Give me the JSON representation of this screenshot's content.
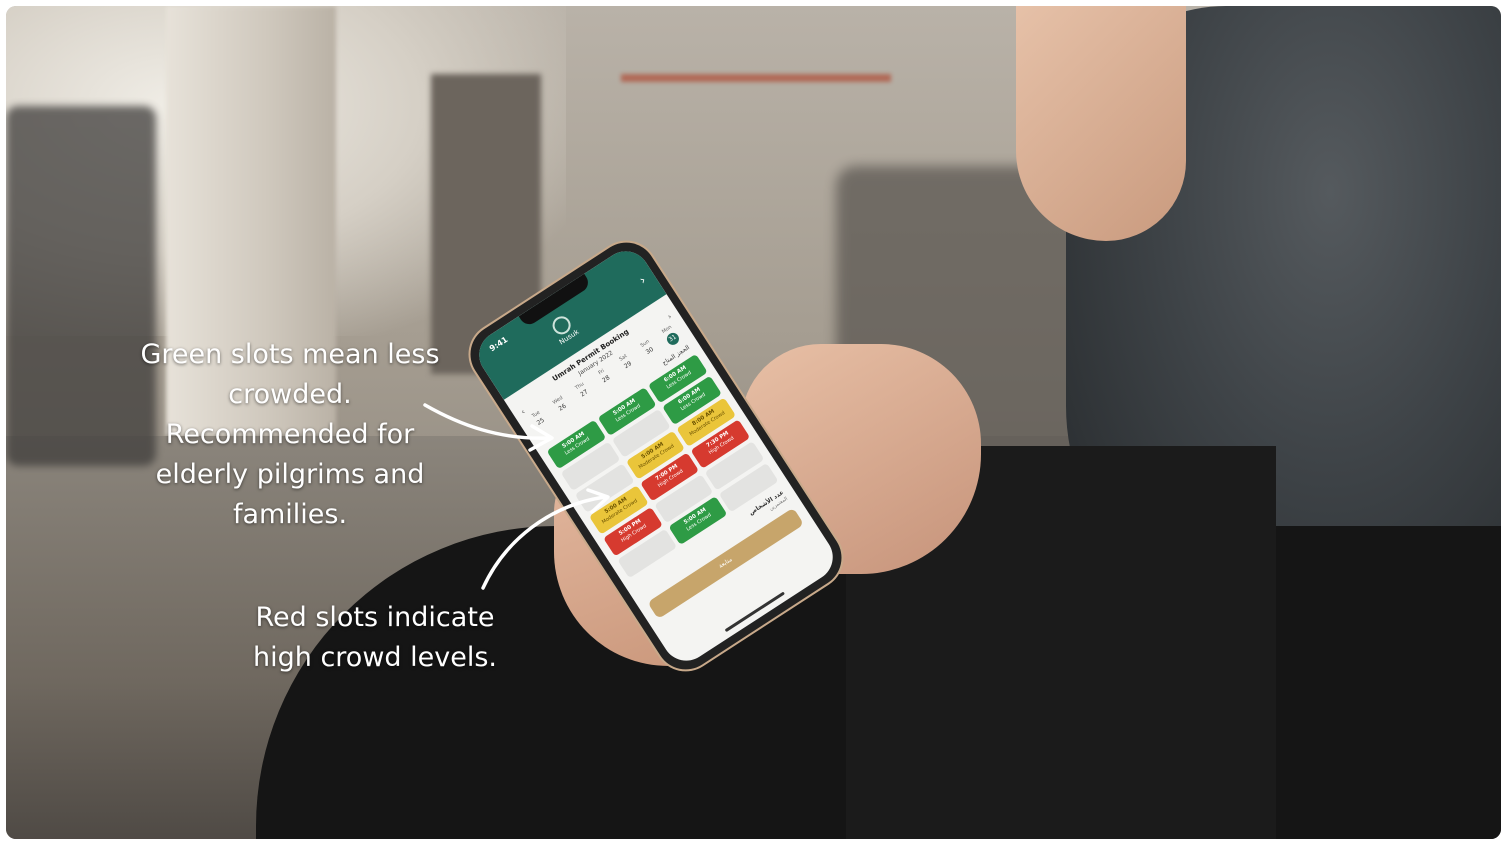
{
  "annotations": {
    "green_note": "Green slots mean less crowded. Recommended for elderly pilgrims and families.",
    "red_note": "Red slots indicate high crowd levels."
  },
  "phone": {
    "status_time": "9:41",
    "app_name": "Nusuk",
    "screen_title": "Umrah Permit Booking",
    "month": "January 2022",
    "days": [
      {
        "dow": "Tue",
        "num": "25"
      },
      {
        "dow": "Wed",
        "num": "26"
      },
      {
        "dow": "Thu",
        "num": "27"
      },
      {
        "dow": "Fri",
        "num": "28"
      },
      {
        "dow": "Sat",
        "num": "29"
      },
      {
        "dow": "Sun",
        "num": "30"
      },
      {
        "dow": "Mon",
        "num": "31"
      }
    ],
    "section_label": "الحجز المتاح",
    "slots": [
      {
        "time": "5:00 AM",
        "level": "Less Crowd",
        "color": "green"
      },
      {
        "time": "5:00 AM",
        "level": "Less Crowd",
        "color": "green"
      },
      {
        "time": "6:00 AM",
        "level": "Less Crowd",
        "color": "green"
      },
      {
        "time": "",
        "level": "",
        "color": "grey"
      },
      {
        "time": "",
        "level": "",
        "color": "grey"
      },
      {
        "time": "6:00 AM",
        "level": "Less Crowd",
        "color": "green"
      },
      {
        "time": "",
        "level": "",
        "color": "grey"
      },
      {
        "time": "5:00 AM",
        "level": "Moderate Crowd",
        "color": "yellow"
      },
      {
        "time": "8:00 AM",
        "level": "Moderate Crowd",
        "color": "yellow"
      },
      {
        "time": "5:00 AM",
        "level": "Moderate Crowd",
        "color": "yellow"
      },
      {
        "time": "7:00 PM",
        "level": "High Crowd",
        "color": "red"
      },
      {
        "time": "7:30 PM",
        "level": "High Crowd",
        "color": "red"
      },
      {
        "time": "5:00 PM",
        "level": "High Crowd",
        "color": "red"
      },
      {
        "time": "",
        "level": "",
        "color": "grey"
      },
      {
        "time": "",
        "level": "",
        "color": "grey"
      },
      {
        "time": "",
        "level": "",
        "color": "grey"
      },
      {
        "time": "5:00 AM",
        "level": "Less Crowd",
        "color": "green"
      },
      {
        "time": "",
        "level": "",
        "color": "grey"
      }
    ],
    "footer_label": "عدد الأشخاص",
    "footer_sub": "المعتمرين",
    "continue_label": "متابعة"
  }
}
